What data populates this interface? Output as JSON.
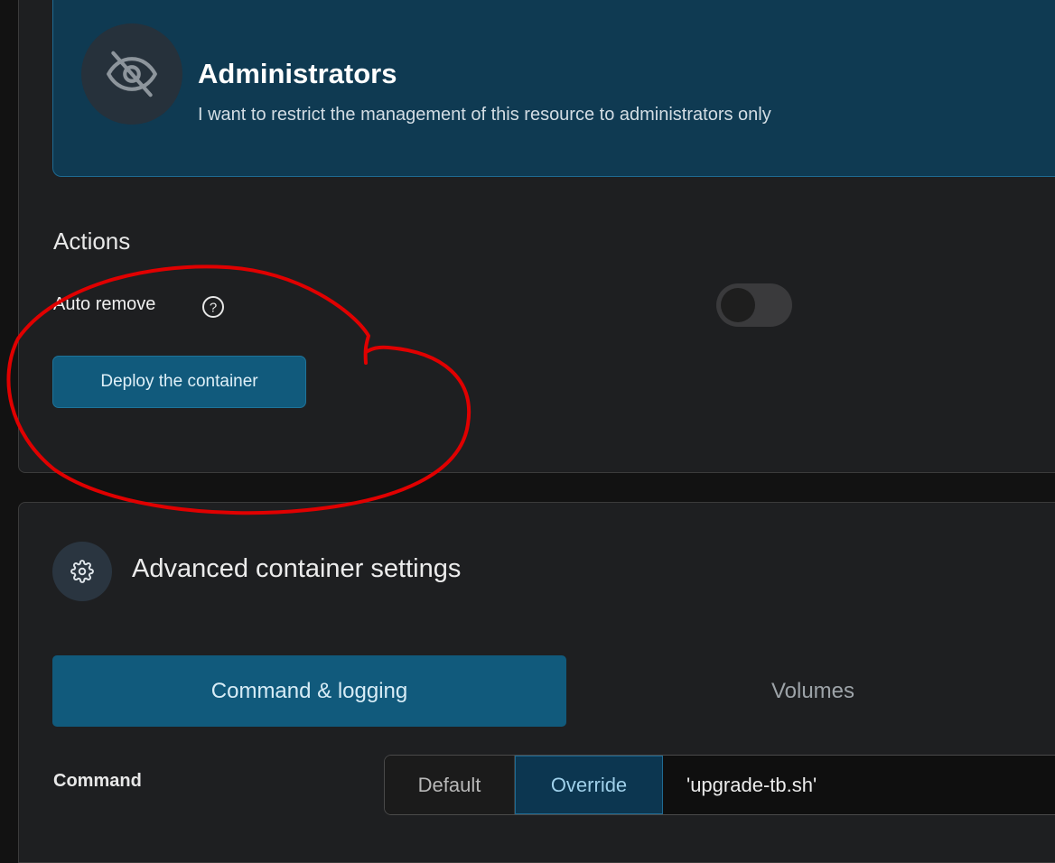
{
  "access_control": {
    "title": "Administrators",
    "description": "I want to restrict the management of this resource to administrators only",
    "icon": "eye-slash-icon"
  },
  "actions": {
    "section_title": "Actions",
    "auto_remove_label": "Auto remove",
    "auto_remove_enabled": false,
    "deploy_button_label": "Deploy the container"
  },
  "advanced_settings": {
    "title": "Advanced container settings",
    "icon": "gear-icon",
    "tabs": [
      {
        "label": "Command & logging",
        "active": true
      },
      {
        "label": "Volumes",
        "active": false
      }
    ],
    "command": {
      "label": "Command",
      "mode_default_label": "Default",
      "mode_override_label": "Override",
      "selected_mode": "Override",
      "value": "'upgrade-tb.sh'"
    }
  },
  "annotation": {
    "color": "#e00000"
  }
}
